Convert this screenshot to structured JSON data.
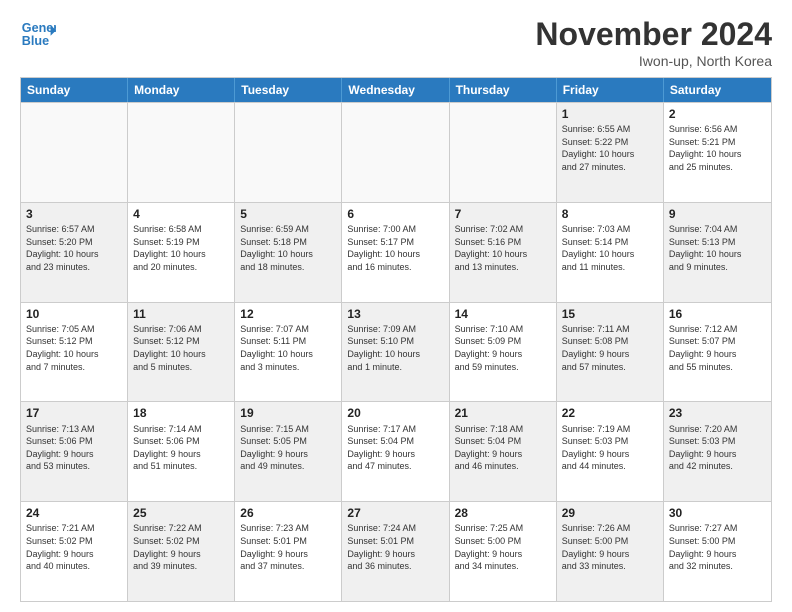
{
  "header": {
    "logo_line1": "General",
    "logo_line2": "Blue",
    "month": "November 2024",
    "location": "Iwon-up, North Korea"
  },
  "weekdays": [
    "Sunday",
    "Monday",
    "Tuesday",
    "Wednesday",
    "Thursday",
    "Friday",
    "Saturday"
  ],
  "rows": [
    [
      {
        "day": "",
        "text": "",
        "empty": true
      },
      {
        "day": "",
        "text": "",
        "empty": true
      },
      {
        "day": "",
        "text": "",
        "empty": true
      },
      {
        "day": "",
        "text": "",
        "empty": true
      },
      {
        "day": "",
        "text": "",
        "empty": true
      },
      {
        "day": "1",
        "text": "Sunrise: 6:55 AM\nSunset: 5:22 PM\nDaylight: 10 hours\nand 27 minutes.",
        "shaded": true
      },
      {
        "day": "2",
        "text": "Sunrise: 6:56 AM\nSunset: 5:21 PM\nDaylight: 10 hours\nand 25 minutes.",
        "shaded": false
      }
    ],
    [
      {
        "day": "3",
        "text": "Sunrise: 6:57 AM\nSunset: 5:20 PM\nDaylight: 10 hours\nand 23 minutes.",
        "shaded": true
      },
      {
        "day": "4",
        "text": "Sunrise: 6:58 AM\nSunset: 5:19 PM\nDaylight: 10 hours\nand 20 minutes.",
        "shaded": false
      },
      {
        "day": "5",
        "text": "Sunrise: 6:59 AM\nSunset: 5:18 PM\nDaylight: 10 hours\nand 18 minutes.",
        "shaded": true
      },
      {
        "day": "6",
        "text": "Sunrise: 7:00 AM\nSunset: 5:17 PM\nDaylight: 10 hours\nand 16 minutes.",
        "shaded": false
      },
      {
        "day": "7",
        "text": "Sunrise: 7:02 AM\nSunset: 5:16 PM\nDaylight: 10 hours\nand 13 minutes.",
        "shaded": true
      },
      {
        "day": "8",
        "text": "Sunrise: 7:03 AM\nSunset: 5:14 PM\nDaylight: 10 hours\nand 11 minutes.",
        "shaded": false
      },
      {
        "day": "9",
        "text": "Sunrise: 7:04 AM\nSunset: 5:13 PM\nDaylight: 10 hours\nand 9 minutes.",
        "shaded": true
      }
    ],
    [
      {
        "day": "10",
        "text": "Sunrise: 7:05 AM\nSunset: 5:12 PM\nDaylight: 10 hours\nand 7 minutes.",
        "shaded": false
      },
      {
        "day": "11",
        "text": "Sunrise: 7:06 AM\nSunset: 5:12 PM\nDaylight: 10 hours\nand 5 minutes.",
        "shaded": true
      },
      {
        "day": "12",
        "text": "Sunrise: 7:07 AM\nSunset: 5:11 PM\nDaylight: 10 hours\nand 3 minutes.",
        "shaded": false
      },
      {
        "day": "13",
        "text": "Sunrise: 7:09 AM\nSunset: 5:10 PM\nDaylight: 10 hours\nand 1 minute.",
        "shaded": true
      },
      {
        "day": "14",
        "text": "Sunrise: 7:10 AM\nSunset: 5:09 PM\nDaylight: 9 hours\nand 59 minutes.",
        "shaded": false
      },
      {
        "day": "15",
        "text": "Sunrise: 7:11 AM\nSunset: 5:08 PM\nDaylight: 9 hours\nand 57 minutes.",
        "shaded": true
      },
      {
        "day": "16",
        "text": "Sunrise: 7:12 AM\nSunset: 5:07 PM\nDaylight: 9 hours\nand 55 minutes.",
        "shaded": false
      }
    ],
    [
      {
        "day": "17",
        "text": "Sunrise: 7:13 AM\nSunset: 5:06 PM\nDaylight: 9 hours\nand 53 minutes.",
        "shaded": true
      },
      {
        "day": "18",
        "text": "Sunrise: 7:14 AM\nSunset: 5:06 PM\nDaylight: 9 hours\nand 51 minutes.",
        "shaded": false
      },
      {
        "day": "19",
        "text": "Sunrise: 7:15 AM\nSunset: 5:05 PM\nDaylight: 9 hours\nand 49 minutes.",
        "shaded": true
      },
      {
        "day": "20",
        "text": "Sunrise: 7:17 AM\nSunset: 5:04 PM\nDaylight: 9 hours\nand 47 minutes.",
        "shaded": false
      },
      {
        "day": "21",
        "text": "Sunrise: 7:18 AM\nSunset: 5:04 PM\nDaylight: 9 hours\nand 46 minutes.",
        "shaded": true
      },
      {
        "day": "22",
        "text": "Sunrise: 7:19 AM\nSunset: 5:03 PM\nDaylight: 9 hours\nand 44 minutes.",
        "shaded": false
      },
      {
        "day": "23",
        "text": "Sunrise: 7:20 AM\nSunset: 5:03 PM\nDaylight: 9 hours\nand 42 minutes.",
        "shaded": true
      }
    ],
    [
      {
        "day": "24",
        "text": "Sunrise: 7:21 AM\nSunset: 5:02 PM\nDaylight: 9 hours\nand 40 minutes.",
        "shaded": false
      },
      {
        "day": "25",
        "text": "Sunrise: 7:22 AM\nSunset: 5:02 PM\nDaylight: 9 hours\nand 39 minutes.",
        "shaded": true
      },
      {
        "day": "26",
        "text": "Sunrise: 7:23 AM\nSunset: 5:01 PM\nDaylight: 9 hours\nand 37 minutes.",
        "shaded": false
      },
      {
        "day": "27",
        "text": "Sunrise: 7:24 AM\nSunset: 5:01 PM\nDaylight: 9 hours\nand 36 minutes.",
        "shaded": true
      },
      {
        "day": "28",
        "text": "Sunrise: 7:25 AM\nSunset: 5:00 PM\nDaylight: 9 hours\nand 34 minutes.",
        "shaded": false
      },
      {
        "day": "29",
        "text": "Sunrise: 7:26 AM\nSunset: 5:00 PM\nDaylight: 9 hours\nand 33 minutes.",
        "shaded": true
      },
      {
        "day": "30",
        "text": "Sunrise: 7:27 AM\nSunset: 5:00 PM\nDaylight: 9 hours\nand 32 minutes.",
        "shaded": false
      }
    ]
  ]
}
